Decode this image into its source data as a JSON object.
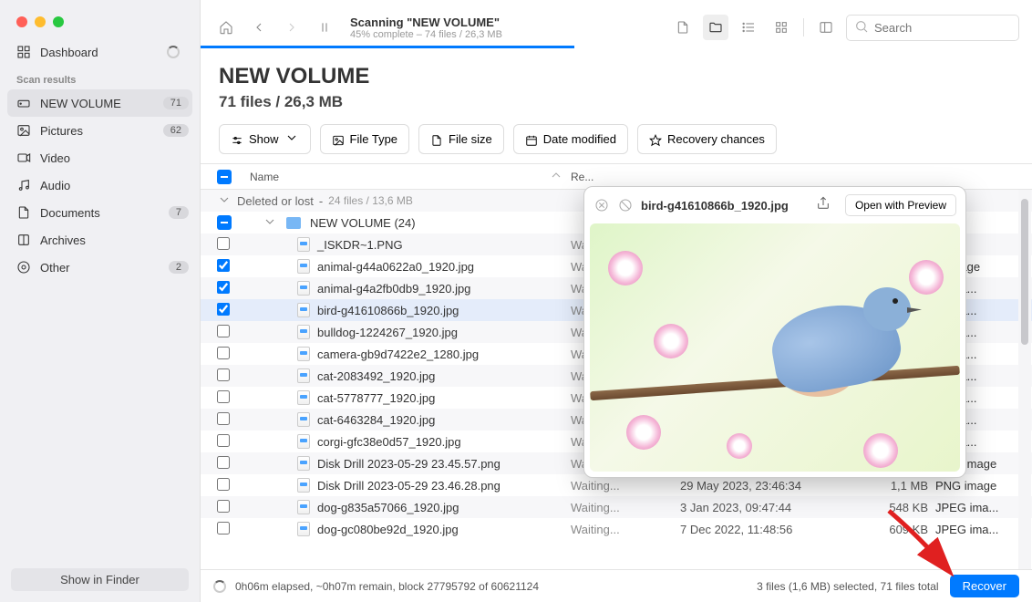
{
  "toolbar": {
    "title": "Scanning \"NEW VOLUME\"",
    "subtitle": "45% complete – 74 files / 26,3 MB",
    "progress_percent": 45,
    "search_placeholder": "Search"
  },
  "sidebar": {
    "dashboard": "Dashboard",
    "scan_results_heading": "Scan results",
    "items": [
      {
        "icon": "drive-icon",
        "label": "NEW VOLUME",
        "badge": "71",
        "selected": true
      },
      {
        "icon": "pictures-icon",
        "label": "Pictures",
        "badge": "62"
      },
      {
        "icon": "video-icon",
        "label": "Video",
        "badge": ""
      },
      {
        "icon": "audio-icon",
        "label": "Audio",
        "badge": ""
      },
      {
        "icon": "documents-icon",
        "label": "Documents",
        "badge": "7"
      },
      {
        "icon": "archives-icon",
        "label": "Archives",
        "badge": ""
      },
      {
        "icon": "other-icon",
        "label": "Other",
        "badge": "2"
      }
    ],
    "footer_btn": "Show in Finder"
  },
  "header": {
    "title": "NEW VOLUME",
    "subtitle": "71 files / 26,3 MB"
  },
  "filters": {
    "show": "Show",
    "file_type": "File Type",
    "file_size": "File size",
    "date_modified": "Date modified",
    "recovery_chances": "Recovery chances"
  },
  "columns": {
    "name": "Name",
    "recovery": "Re...",
    "date": "",
    "size": "",
    "type": ""
  },
  "group": {
    "label": "Deleted or lost",
    "meta": "24 files / 13,6 MB"
  },
  "folder": {
    "label": "NEW VOLUME (24)"
  },
  "files": [
    {
      "checked": false,
      "name": "_ISKDR~1.PNG",
      "rec": "Wa...",
      "date": "",
      "size": "",
      "type": "er"
    },
    {
      "checked": true,
      "name": "animal-g44a0622a0_1920.jpg",
      "rec": "Wa...",
      "date": "",
      "size": "",
      "type": "G image"
    },
    {
      "checked": true,
      "name": "animal-g4a2fb0db9_1920.jpg",
      "rec": "Wa...",
      "date": "",
      "size": "",
      "type": "G ima..."
    },
    {
      "checked": true,
      "name": "bird-g41610866b_1920.jpg",
      "rec": "Wa...",
      "date": "",
      "size": "",
      "type": "G ima...",
      "selected": true
    },
    {
      "checked": false,
      "name": "bulldog-1224267_1920.jpg",
      "rec": "Wa...",
      "date": "",
      "size": "",
      "type": "G ima..."
    },
    {
      "checked": false,
      "name": "camera-gb9d7422e2_1280.jpg",
      "rec": "Wa...",
      "date": "",
      "size": "",
      "type": "G ima..."
    },
    {
      "checked": false,
      "name": "cat-2083492_1920.jpg",
      "rec": "Wa...",
      "date": "",
      "size": "",
      "type": "G ima..."
    },
    {
      "checked": false,
      "name": "cat-5778777_1920.jpg",
      "rec": "Wa...",
      "date": "",
      "size": "",
      "type": "G ima..."
    },
    {
      "checked": false,
      "name": "cat-6463284_1920.jpg",
      "rec": "Wa...",
      "date": "",
      "size": "",
      "type": "G ima..."
    },
    {
      "checked": false,
      "name": "corgi-gfc38e0d57_1920.jpg",
      "rec": "Wa...",
      "date": "",
      "size": "",
      "type": "G ima..."
    },
    {
      "checked": false,
      "name": "Disk Drill 2023-05-29 23.45.57.png",
      "rec": "Waiting...",
      "date": "29 May 2023, 23:46:02",
      "size": "1,2 MB",
      "type": "PNG image"
    },
    {
      "checked": false,
      "name": "Disk Drill 2023-05-29 23.46.28.png",
      "rec": "Waiting...",
      "date": "29 May 2023, 23:46:34",
      "size": "1,1 MB",
      "type": "PNG image"
    },
    {
      "checked": false,
      "name": "dog-g835a57066_1920.jpg",
      "rec": "Waiting...",
      "date": "3 Jan 2023, 09:47:44",
      "size": "548 KB",
      "type": "JPEG ima..."
    },
    {
      "checked": false,
      "name": "dog-gc080be92d_1920.jpg",
      "rec": "Waiting...",
      "date": "7 Dec 2022, 11:48:56",
      "size": "609 KB",
      "type": "JPEG ima..."
    }
  ],
  "footer": {
    "status": "0h06m elapsed, ~0h07m remain, block 27795792 of 60621124",
    "selection": "3 files (1,6 MB) selected, 71 files total",
    "recover": "Recover"
  },
  "preview": {
    "filename": "bird-g41610866b_1920.jpg",
    "open_btn": "Open with Preview"
  }
}
